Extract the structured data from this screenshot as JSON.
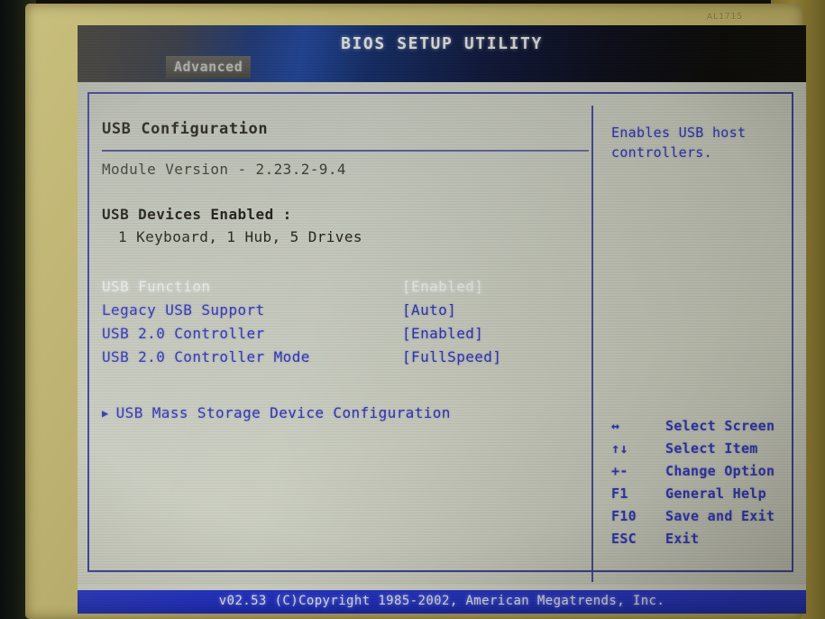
{
  "bezel": {
    "marking": "AL1715"
  },
  "header": {
    "title": "BIOS SETUP UTILITY",
    "tabs": [
      {
        "label": "Advanced",
        "active": true
      }
    ]
  },
  "main": {
    "section_title": "USB Configuration",
    "module_version": "Module Version - 2.23.2-9.4",
    "devices_heading": "USB Devices Enabled :",
    "devices_list": "1 Keyboard, 1 Hub, 5 Drives",
    "settings": [
      {
        "label": "USB Function",
        "value": "[Enabled]",
        "selected": true
      },
      {
        "label": "Legacy USB Support",
        "value": "[Auto]",
        "selected": false
      },
      {
        "label": "USB 2.0 Controller",
        "value": "[Enabled]",
        "selected": false
      },
      {
        "label": "USB 2.0 Controller Mode",
        "value": "[FullSpeed]",
        "selected": false
      }
    ],
    "submenu": {
      "arrow": "▶",
      "label": "USB Mass Storage Device Configuration"
    }
  },
  "help": {
    "text": "Enables USB host controllers.",
    "keys": [
      {
        "symbol": "↔",
        "description": "Select Screen"
      },
      {
        "symbol": "↑↓",
        "description": "Select Item"
      },
      {
        "symbol": "+-",
        "description": "Change Option"
      },
      {
        "symbol": "F1",
        "description": "General Help"
      },
      {
        "symbol": "F10",
        "description": "Save and Exit"
      },
      {
        "symbol": "ESC",
        "description": "Exit"
      }
    ]
  },
  "footer": {
    "text": "v02.53 (C)Copyright 1985-2002, American Megatrends, Inc."
  },
  "colors": {
    "accent_blue": "#2f34b4",
    "header_blue": "#1b3d8c",
    "footer_blue": "#1f2ec0",
    "screen_bg": "#c6c9bd",
    "selected_text": "#e8eae2",
    "bezel": "#bdb271"
  }
}
